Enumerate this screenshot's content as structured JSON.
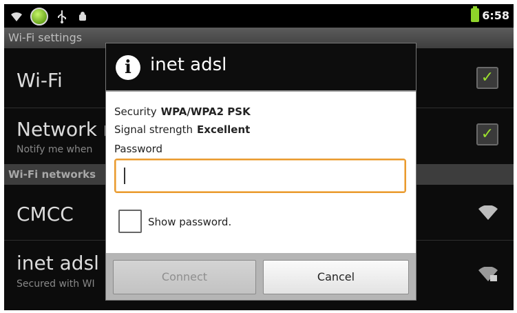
{
  "status_bar": {
    "icons": [
      "wifi-icon",
      "android-icon",
      "usb-icon",
      "debug-icon"
    ],
    "time": "6:58",
    "battery_color": "#8fd32a"
  },
  "settings": {
    "page_title": "Wi-Fi settings",
    "wifi_label": "Wi-Fi",
    "wifi_checked": true,
    "network_notify_label": "Network n",
    "network_notify_sub": "Notify me when",
    "network_notify_checked": true,
    "section_header": "Wi-Fi networks",
    "networks": [
      {
        "name": "CMCC",
        "sub": ""
      },
      {
        "name": "inet adsl",
        "sub": "Secured with WI"
      }
    ]
  },
  "dialog": {
    "title": "inet adsl",
    "security_label": "Security",
    "security_value": "WPA/WPA2 PSK",
    "signal_label": "Signal strength",
    "signal_value": "Excellent",
    "password_label": "Password",
    "password_value": "",
    "show_password_label": "Show password.",
    "show_password_checked": false,
    "connect_label": "Connect",
    "cancel_label": "Cancel",
    "accent_color": "#e99a2e"
  }
}
